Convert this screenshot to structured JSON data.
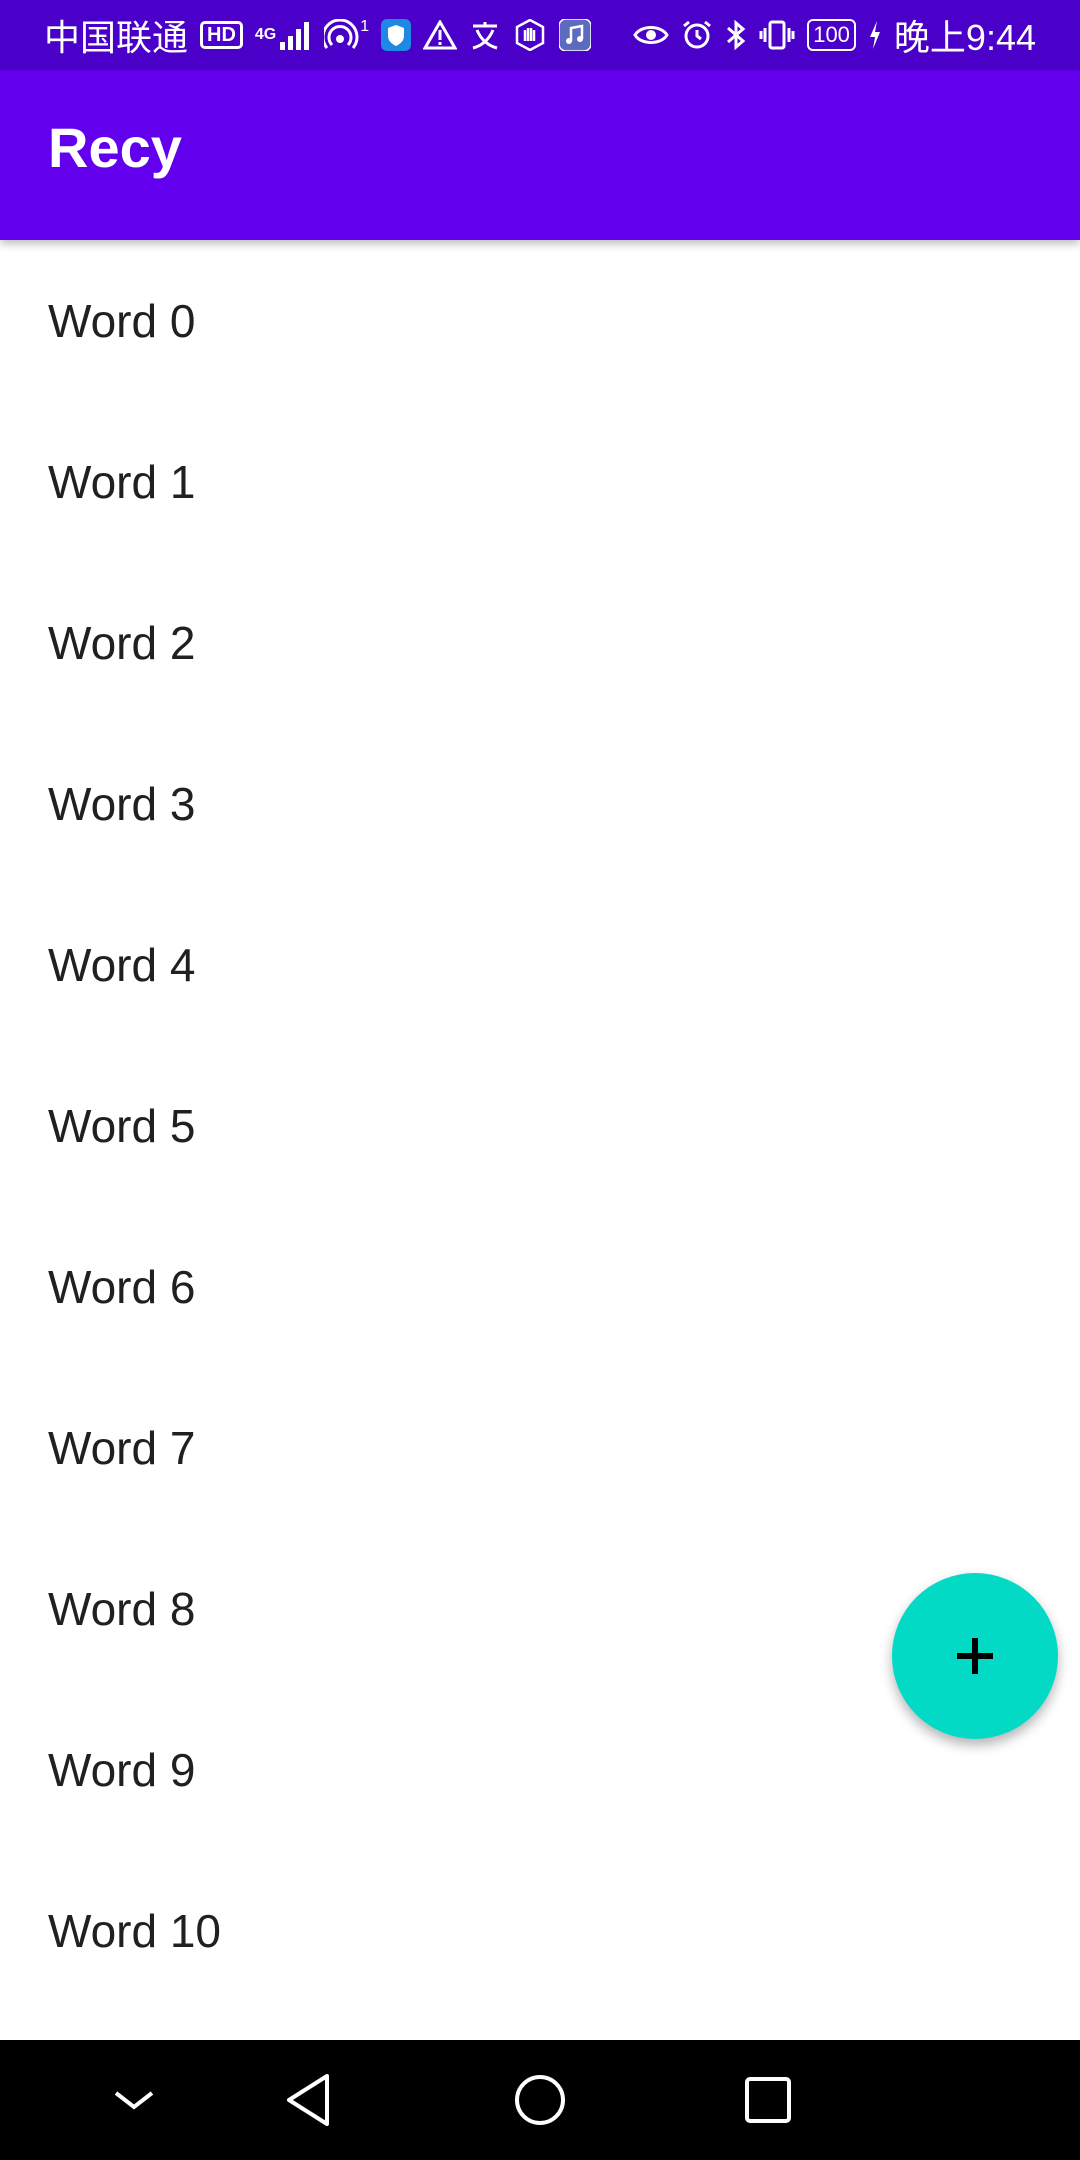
{
  "status_bar": {
    "carrier": "中国联通",
    "hd": "HD",
    "network": "4G",
    "hotspot_count": "1",
    "battery": "100",
    "time": "晚上9:44",
    "icons": [
      "hd-icon",
      "signal-icon",
      "hotspot-icon",
      "shield-icon",
      "warning-icon",
      "translate-icon",
      "hand-icon",
      "music-icon",
      "eye-icon",
      "alarm-icon",
      "bluetooth-icon",
      "vibrate-icon",
      "battery-icon",
      "charging-icon"
    ]
  },
  "app_bar": {
    "title": "Recy"
  },
  "words": [
    "Word 0",
    "Word 1",
    "Word 2",
    "Word 3",
    "Word 4",
    "Word 5",
    "Word 6",
    "Word 7",
    "Word 8",
    "Word 9",
    "Word 10"
  ],
  "fab": {
    "icon": "plus-icon",
    "color": "#03dac5"
  },
  "nav_bar": {
    "buttons": [
      "collapse-icon",
      "back-icon",
      "home-icon",
      "recents-icon"
    ]
  },
  "colors": {
    "primary": "#6200ee",
    "primary_dark": "#4a00c8",
    "accent": "#03dac5"
  }
}
